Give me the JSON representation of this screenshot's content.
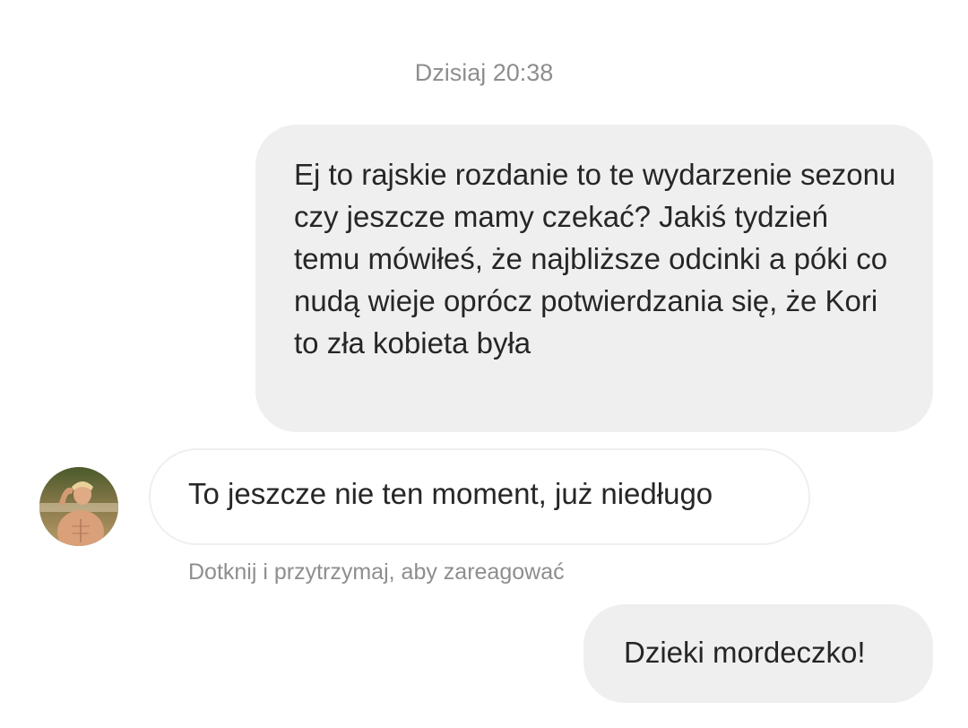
{
  "thread": {
    "timestamp": "Dzisiaj 20:38",
    "messages": [
      {
        "direction": "outgoing",
        "text": "Ej to rajskie rozdanie to te wydarzenie sezonu czy jeszcze mamy czekać? Jakiś tydzień temu mówiłeś, że najbliższe odcinki a póki co nudą wieje oprócz potwierdzania się, że Kori to zła kobieta była"
      },
      {
        "direction": "incoming",
        "text": "To jeszcze nie ten moment, już niedługo"
      },
      {
        "direction": "outgoing",
        "text": "Dzieki mordeczko!"
      }
    ],
    "reaction_hint": "Dotknij i przytrzymaj, aby zareagować"
  },
  "colors": {
    "outgoing_bubble": "#efefef",
    "incoming_border": "#efefef",
    "text": "#262626",
    "meta_text": "#8e8e8e",
    "background": "#ffffff"
  }
}
